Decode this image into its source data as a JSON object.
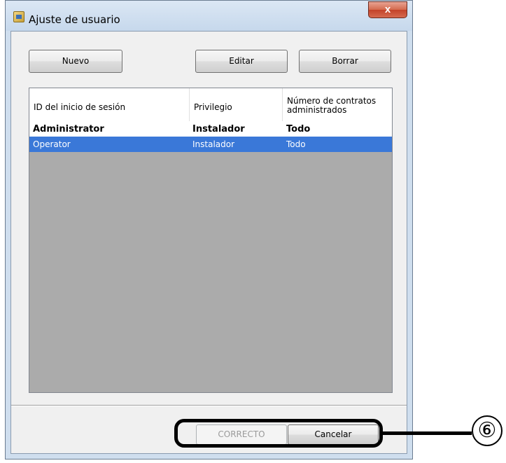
{
  "window": {
    "title": "Ajuste de usuario",
    "icon": "user-settings-icon",
    "close_glyph": "x"
  },
  "toolbar": {
    "new_label": "Nuevo",
    "edit_label": "Editar",
    "delete_label": "Borrar"
  },
  "table": {
    "columns": [
      "ID del inicio de sesión",
      "Privilegio",
      "Número de contratos administrados"
    ],
    "rows": [
      {
        "id": "Administrator",
        "privilege": "Instalador",
        "contracts": "Todo",
        "selected": false
      },
      {
        "id": "Operator",
        "privilege": "Instalador",
        "contracts": "Todo",
        "selected": true
      }
    ]
  },
  "footer": {
    "ok_label": "CORRECTO",
    "ok_enabled": false,
    "cancel_label": "Cancelar"
  },
  "annotation": {
    "callout_number": "⑥"
  },
  "colors": {
    "selection": "#3a78d8",
    "list_background": "#ababab",
    "close_button": "#c3432a"
  }
}
